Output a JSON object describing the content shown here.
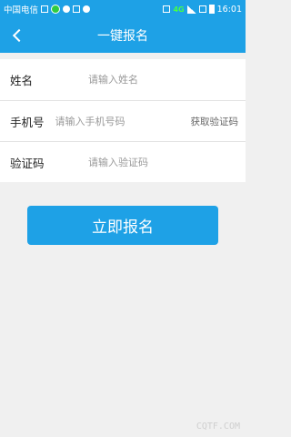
{
  "status_bar": {
    "carrier": "中国电信",
    "network": "4G",
    "time": "16:01"
  },
  "header": {
    "title": "一键报名",
    "back_icon": "chevron-left-icon"
  },
  "form": {
    "name": {
      "label": "姓名",
      "placeholder": "请输入姓名"
    },
    "phone": {
      "label": "手机号",
      "placeholder": "请输入手机号码",
      "code_button": "获取验证码"
    },
    "code": {
      "label": "验证码",
      "placeholder": "请输入验证码"
    }
  },
  "submit": {
    "label": "立即报名"
  },
  "watermark": "CQTF.COM",
  "colors": {
    "primary": "#1ea1e6",
    "background": "#f0f0f0"
  }
}
